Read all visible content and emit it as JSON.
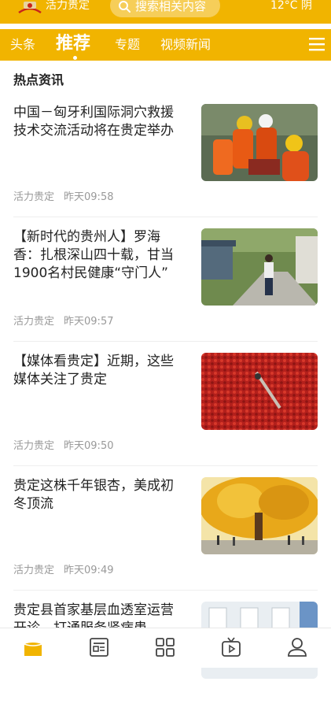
{
  "header": {
    "app_name": "活力贵定",
    "search_placeholder": "搜索相关内容",
    "weather": "12°C 阴"
  },
  "tabs": [
    {
      "label": "头条",
      "active": false
    },
    {
      "label": "推荐",
      "active": true
    },
    {
      "label": "专题",
      "active": false
    },
    {
      "label": "视频新闻",
      "active": false
    }
  ],
  "section_title": "热点资讯",
  "articles": [
    {
      "title": "中国－匈牙利国际洞穴救援技术交流活动将在贵定举办",
      "source": "活力贵定",
      "time": "昨天09:58",
      "image": "rescue-team-photo"
    },
    {
      "title": "【新时代的贵州人】罗海香：扎根深山四十载，甘当1900名村民健康“守门人”",
      "source": "活力贵定",
      "time": "昨天09:57",
      "image": "village-doctor-photo"
    },
    {
      "title": "【媒体看贵定】近期，这些媒体关注了贵定",
      "source": "活力贵定",
      "time": "昨天09:50",
      "image": "red-chili-drying-photo"
    },
    {
      "title": "贵定这株千年银杏，美成初冬顶流",
      "source": "活力贵定",
      "time": "昨天09:49",
      "image": "ginkgo-tree-photo"
    },
    {
      "title": "贵定县首家基层血透室运营开诊，打通服务肾病患",
      "source": "",
      "time": "",
      "image": "dialysis-room-photo"
    }
  ],
  "bottom_nav": [
    {
      "icon": "home-icon",
      "active": true
    },
    {
      "icon": "news-icon",
      "active": false
    },
    {
      "icon": "grid-icon",
      "active": false
    },
    {
      "icon": "tv-icon",
      "active": false
    },
    {
      "icon": "user-icon",
      "active": false
    }
  ],
  "colors": {
    "accent": "#F1B400",
    "text": "#222222",
    "meta": "#999999"
  }
}
